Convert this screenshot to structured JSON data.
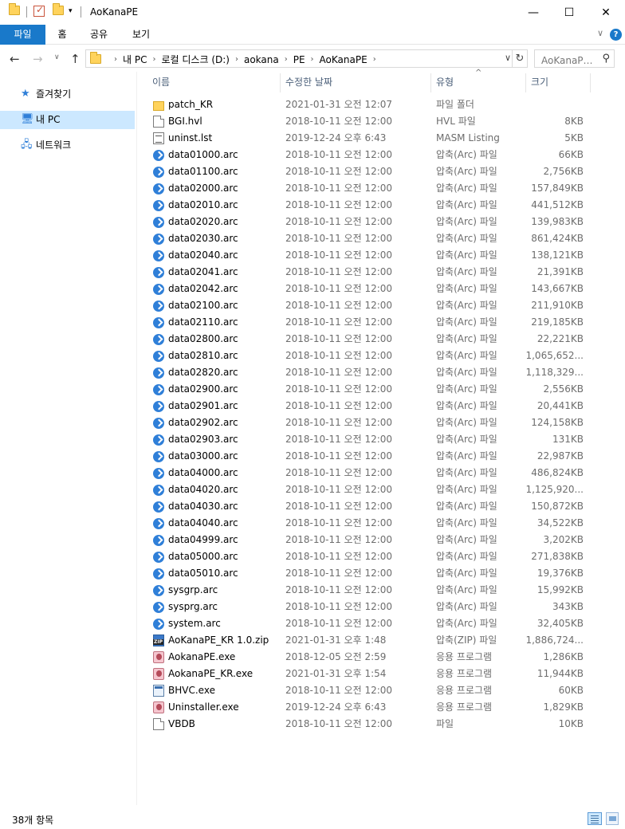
{
  "window": {
    "title": "AoKanaPE",
    "minimize_glyph": "—",
    "maximize_glyph": "☐",
    "close_glyph": "✕"
  },
  "ribbon": {
    "tabs": [
      "파일",
      "홈",
      "공유",
      "보기"
    ],
    "expand_glyph": "∨",
    "help_glyph": "?"
  },
  "nav": {
    "back_glyph": "←",
    "forward_glyph": "→",
    "recent_glyph": "∨",
    "up_glyph": "↑",
    "breadcrumbs": [
      "내 PC",
      "로컬 디스크 (D:)",
      "aokana",
      "PE",
      "AoKanaPE"
    ],
    "crumb_sep": "›",
    "dropdown_glyph": "∨",
    "refresh_glyph": "↻",
    "search_placeholder": "AoKanaPE 검색",
    "search_glyph": "⚲"
  },
  "sidebar": {
    "items": [
      {
        "label": "즐겨찾기",
        "icon": "star-icon",
        "glyph": "★"
      },
      {
        "label": "내 PC",
        "icon": "pc-icon",
        "glyph": "🖥"
      },
      {
        "label": "네트워크",
        "icon": "network-icon",
        "glyph": "🖧"
      }
    ]
  },
  "columns": {
    "name": "이름",
    "date": "수정한 날짜",
    "type": "유형",
    "size": "크기",
    "sort_glyph": "^"
  },
  "files": [
    {
      "name": "patch_KR",
      "date": "2021-01-31 오전 12:07",
      "type": "파일 폴더",
      "size": "",
      "icon": "folder"
    },
    {
      "name": "BGI.hvl",
      "date": "2018-10-11 오전 12:00",
      "type": "HVL 파일",
      "size": "8KB",
      "icon": "doc"
    },
    {
      "name": "uninst.lst",
      "date": "2019-12-24 오후 6:43",
      "type": "MASM Listing",
      "size": "5KB",
      "icon": "txt"
    },
    {
      "name": "data01000.arc",
      "date": "2018-10-11 오전 12:00",
      "type": "압축(Arc) 파일",
      "size": "66KB",
      "icon": "arc"
    },
    {
      "name": "data01100.arc",
      "date": "2018-10-11 오전 12:00",
      "type": "압축(Arc) 파일",
      "size": "2,756KB",
      "icon": "arc"
    },
    {
      "name": "data02000.arc",
      "date": "2018-10-11 오전 12:00",
      "type": "압축(Arc) 파일",
      "size": "157,849KB",
      "icon": "arc"
    },
    {
      "name": "data02010.arc",
      "date": "2018-10-11 오전 12:00",
      "type": "압축(Arc) 파일",
      "size": "441,512KB",
      "icon": "arc"
    },
    {
      "name": "data02020.arc",
      "date": "2018-10-11 오전 12:00",
      "type": "압축(Arc) 파일",
      "size": "139,983KB",
      "icon": "arc"
    },
    {
      "name": "data02030.arc",
      "date": "2018-10-11 오전 12:00",
      "type": "압축(Arc) 파일",
      "size": "861,424KB",
      "icon": "arc"
    },
    {
      "name": "data02040.arc",
      "date": "2018-10-11 오전 12:00",
      "type": "압축(Arc) 파일",
      "size": "138,121KB",
      "icon": "arc"
    },
    {
      "name": "data02041.arc",
      "date": "2018-10-11 오전 12:00",
      "type": "압축(Arc) 파일",
      "size": "21,391KB",
      "icon": "arc"
    },
    {
      "name": "data02042.arc",
      "date": "2018-10-11 오전 12:00",
      "type": "압축(Arc) 파일",
      "size": "143,667KB",
      "icon": "arc"
    },
    {
      "name": "data02100.arc",
      "date": "2018-10-11 오전 12:00",
      "type": "압축(Arc) 파일",
      "size": "211,910KB",
      "icon": "arc"
    },
    {
      "name": "data02110.arc",
      "date": "2018-10-11 오전 12:00",
      "type": "압축(Arc) 파일",
      "size": "219,185KB",
      "icon": "arc"
    },
    {
      "name": "data02800.arc",
      "date": "2018-10-11 오전 12:00",
      "type": "압축(Arc) 파일",
      "size": "22,221KB",
      "icon": "arc"
    },
    {
      "name": "data02810.arc",
      "date": "2018-10-11 오전 12:00",
      "type": "압축(Arc) 파일",
      "size": "1,065,652...",
      "icon": "arc"
    },
    {
      "name": "data02820.arc",
      "date": "2018-10-11 오전 12:00",
      "type": "압축(Arc) 파일",
      "size": "1,118,329...",
      "icon": "arc"
    },
    {
      "name": "data02900.arc",
      "date": "2018-10-11 오전 12:00",
      "type": "압축(Arc) 파일",
      "size": "2,556KB",
      "icon": "arc"
    },
    {
      "name": "data02901.arc",
      "date": "2018-10-11 오전 12:00",
      "type": "압축(Arc) 파일",
      "size": "20,441KB",
      "icon": "arc"
    },
    {
      "name": "data02902.arc",
      "date": "2018-10-11 오전 12:00",
      "type": "압축(Arc) 파일",
      "size": "124,158KB",
      "icon": "arc"
    },
    {
      "name": "data02903.arc",
      "date": "2018-10-11 오전 12:00",
      "type": "압축(Arc) 파일",
      "size": "131KB",
      "icon": "arc"
    },
    {
      "name": "data03000.arc",
      "date": "2018-10-11 오전 12:00",
      "type": "압축(Arc) 파일",
      "size": "22,987KB",
      "icon": "arc"
    },
    {
      "name": "data04000.arc",
      "date": "2018-10-11 오전 12:00",
      "type": "압축(Arc) 파일",
      "size": "486,824KB",
      "icon": "arc"
    },
    {
      "name": "data04020.arc",
      "date": "2018-10-11 오전 12:00",
      "type": "압축(Arc) 파일",
      "size": "1,125,920...",
      "icon": "arc"
    },
    {
      "name": "data04030.arc",
      "date": "2018-10-11 오전 12:00",
      "type": "압축(Arc) 파일",
      "size": "150,872KB",
      "icon": "arc"
    },
    {
      "name": "data04040.arc",
      "date": "2018-10-11 오전 12:00",
      "type": "압축(Arc) 파일",
      "size": "34,522KB",
      "icon": "arc"
    },
    {
      "name": "data04999.arc",
      "date": "2018-10-11 오전 12:00",
      "type": "압축(Arc) 파일",
      "size": "3,202KB",
      "icon": "arc"
    },
    {
      "name": "data05000.arc",
      "date": "2018-10-11 오전 12:00",
      "type": "압축(Arc) 파일",
      "size": "271,838KB",
      "icon": "arc"
    },
    {
      "name": "data05010.arc",
      "date": "2018-10-11 오전 12:00",
      "type": "압축(Arc) 파일",
      "size": "19,376KB",
      "icon": "arc"
    },
    {
      "name": "sysgrp.arc",
      "date": "2018-10-11 오전 12:00",
      "type": "압축(Arc) 파일",
      "size": "15,992KB",
      "icon": "arc"
    },
    {
      "name": "sysprg.arc",
      "date": "2018-10-11 오전 12:00",
      "type": "압축(Arc) 파일",
      "size": "343KB",
      "icon": "arc"
    },
    {
      "name": "system.arc",
      "date": "2018-10-11 오전 12:00",
      "type": "압축(Arc) 파일",
      "size": "32,405KB",
      "icon": "arc"
    },
    {
      "name": "AoKanaPE_KR 1.0.zip",
      "date": "2021-01-31 오후 1:48",
      "type": "압축(ZIP) 파일",
      "size": "1,886,724...",
      "icon": "zip"
    },
    {
      "name": "AokanaPE.exe",
      "date": "2018-12-05 오전 2:59",
      "type": "응용 프로그램",
      "size": "1,286KB",
      "icon": "app"
    },
    {
      "name": "AokanaPE_KR.exe",
      "date": "2021-01-31 오후 1:54",
      "type": "응용 프로그램",
      "size": "11,944KB",
      "icon": "app"
    },
    {
      "name": "BHVC.exe",
      "date": "2018-10-11 오전 12:00",
      "type": "응용 프로그램",
      "size": "60KB",
      "icon": "win"
    },
    {
      "name": "Uninstaller.exe",
      "date": "2019-12-24 오후 6:43",
      "type": "응용 프로그램",
      "size": "1,829KB",
      "icon": "app"
    },
    {
      "name": "VBDB",
      "date": "2018-10-11 오전 12:00",
      "type": "파일",
      "size": "10KB",
      "icon": "doc"
    }
  ],
  "status": {
    "item_count": "38개 항목"
  },
  "colors": {
    "accent": "#1979ca",
    "selection": "#cce8ff",
    "header_text": "#4c607a",
    "meta_text": "#6d6d6d"
  }
}
